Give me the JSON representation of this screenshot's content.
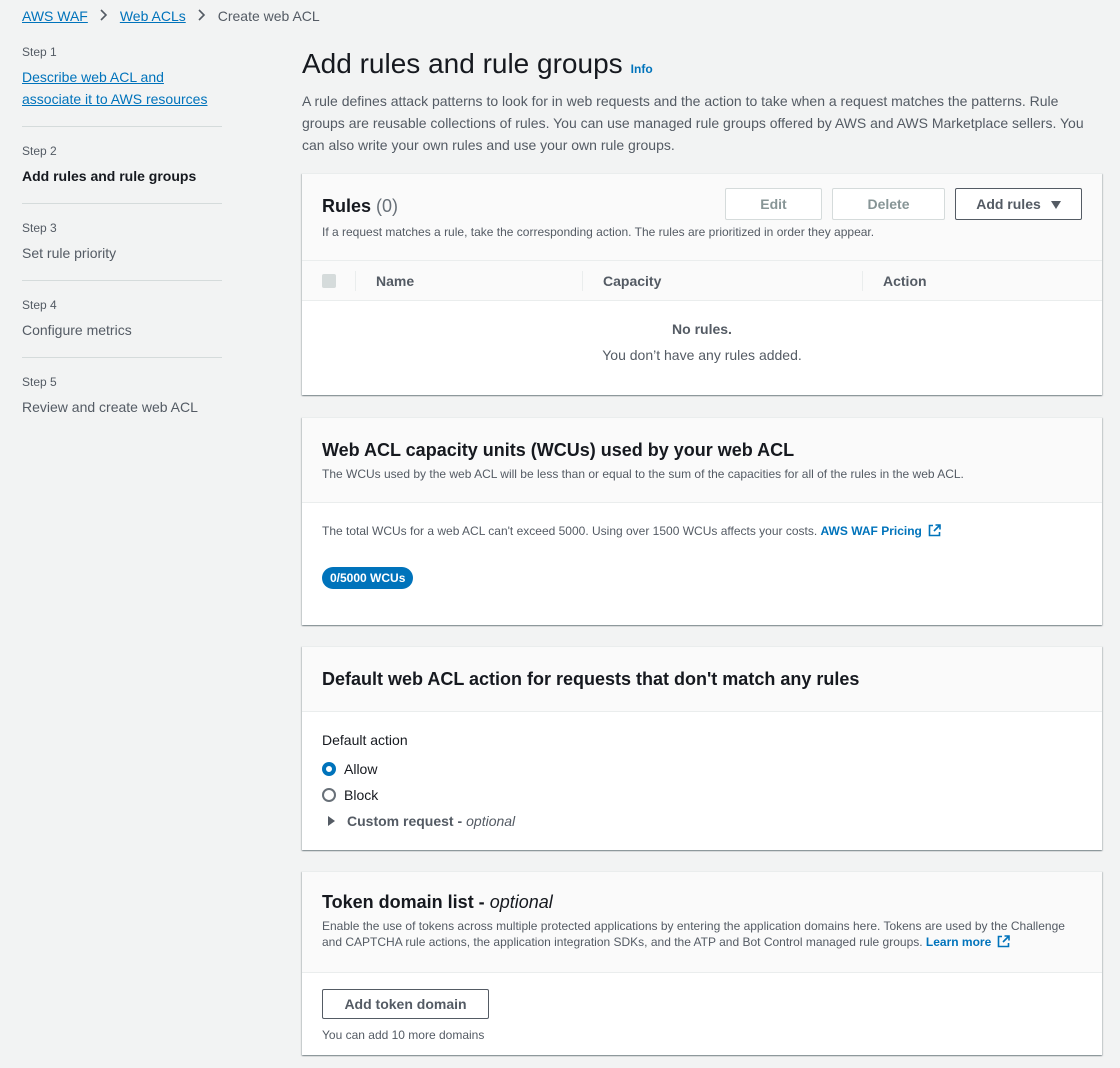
{
  "breadcrumb": {
    "items": [
      "AWS WAF",
      "Web ACLs"
    ],
    "current": "Create web ACL"
  },
  "steps": [
    {
      "num": "Step 1",
      "label": "Describe web ACL and associate it to AWS resources"
    },
    {
      "num": "Step 2",
      "label": "Add rules and rule groups"
    },
    {
      "num": "Step 3",
      "label": "Set rule priority"
    },
    {
      "num": "Step 4",
      "label": "Configure metrics"
    },
    {
      "num": "Step 5",
      "label": "Review and create web ACL"
    }
  ],
  "page": {
    "title": "Add rules and rule groups",
    "info": "Info",
    "description": "A rule defines attack patterns to look for in web requests and the action to take when a request matches the patterns. Rule groups are reusable collections of rules. You can use managed rule groups offered by AWS and AWS Marketplace sellers. You can also write your own rules and use your own rule groups."
  },
  "rules": {
    "title": "Rules",
    "count": "(0)",
    "subtitle": "If a request matches a rule, take the corresponding action. The rules are prioritized in order they appear.",
    "edit": "Edit",
    "delete": "Delete",
    "add": "Add rules",
    "columns": [
      "Name",
      "Capacity",
      "Action"
    ],
    "empty_title": "No rules.",
    "empty_text": "You don’t have any rules added."
  },
  "wcu": {
    "title": "Web ACL capacity units (WCUs) used by your web ACL",
    "subtitle": "The WCUs used by the web ACL will be less than or equal to the sum of the capacities for all of the rules in the web ACL.",
    "note": "The total WCUs for a web ACL can't exceed 5000. Using over 1500 WCUs affects your costs.",
    "pricing_link": "AWS WAF Pricing",
    "badge": "0/5000 WCUs"
  },
  "default_action": {
    "title": "Default web ACL action for requests that don't match any rules",
    "label": "Default action",
    "options": [
      "Allow",
      "Block"
    ],
    "selected": "Allow",
    "custom_request": "Custom request -",
    "optional": "optional"
  },
  "token": {
    "title": "Token domain list -",
    "optional": "optional",
    "subtitle": "Enable the use of tokens across multiple protected applications by entering the application domains here. Tokens are used by the Challenge and CAPTCHA rule actions, the application integration SDKs, and the ATP and Bot Control managed rule groups.",
    "learn_more": "Learn more",
    "add_button": "Add token domain",
    "note": "You can add 10 more domains"
  },
  "colors": {
    "link": "#0073bb",
    "background": "#f2f3f3",
    "badge": "#0073bb"
  }
}
